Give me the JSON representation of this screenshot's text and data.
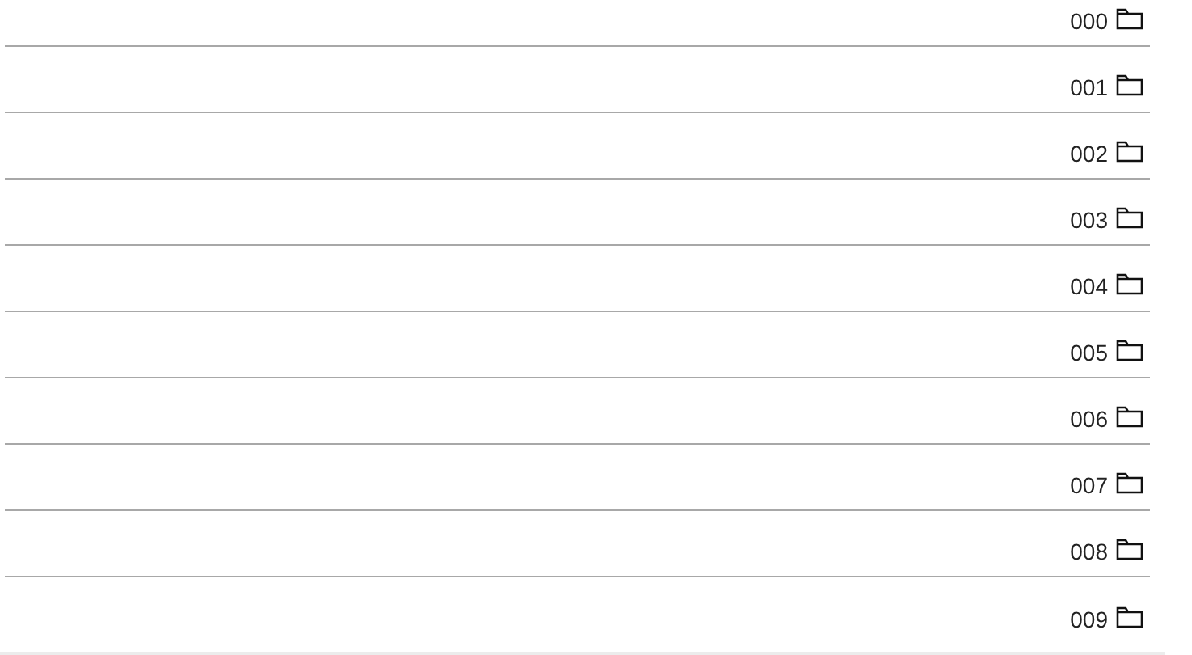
{
  "folders": [
    {
      "label": "000"
    },
    {
      "label": "001"
    },
    {
      "label": "002"
    },
    {
      "label": "003"
    },
    {
      "label": "004"
    },
    {
      "label": "005"
    },
    {
      "label": "006"
    },
    {
      "label": "007"
    },
    {
      "label": "008"
    },
    {
      "label": "009"
    }
  ]
}
